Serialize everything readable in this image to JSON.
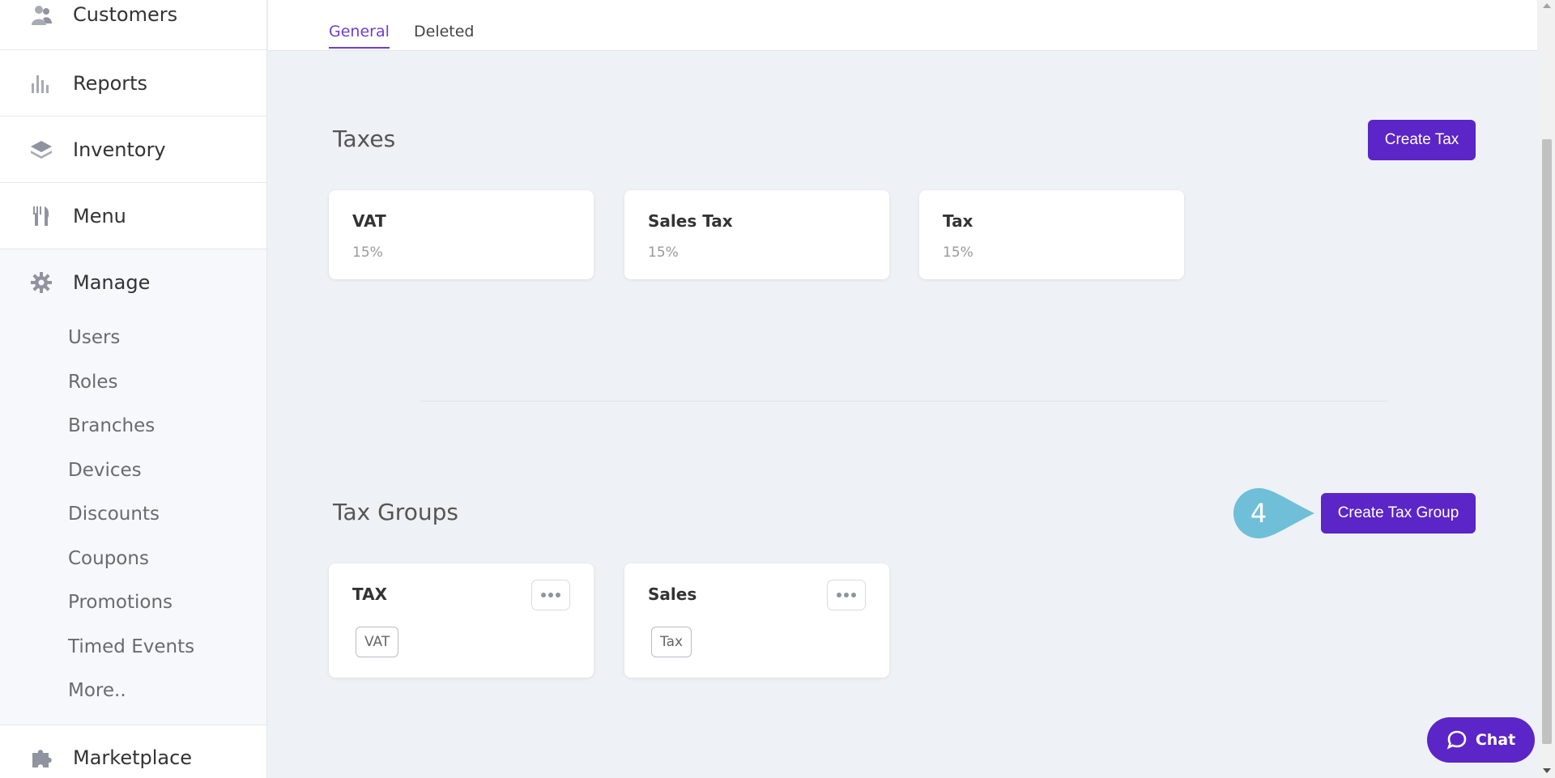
{
  "sidebar": {
    "items": [
      {
        "label": "Customers",
        "icon": "customers-icon"
      },
      {
        "label": "Reports",
        "icon": "reports-icon"
      },
      {
        "label": "Inventory",
        "icon": "inventory-icon"
      },
      {
        "label": "Menu",
        "icon": "menu-icon"
      }
    ],
    "manage": {
      "label": "Manage",
      "icon": "gear-icon",
      "subitems": [
        "Users",
        "Roles",
        "Branches",
        "Devices",
        "Discounts",
        "Coupons",
        "Promotions",
        "Timed Events",
        "More.."
      ]
    },
    "marketplace": {
      "label": "Marketplace",
      "icon": "puzzle-icon"
    }
  },
  "tabs": [
    {
      "label": "General",
      "active": true
    },
    {
      "label": "Deleted",
      "active": false
    }
  ],
  "taxes": {
    "title": "Taxes",
    "create_label": "Create Tax",
    "items": [
      {
        "name": "VAT",
        "rate": "15%"
      },
      {
        "name": "Sales Tax",
        "rate": "15%"
      },
      {
        "name": "Tax",
        "rate": "15%"
      }
    ]
  },
  "tax_groups": {
    "title": "Tax Groups",
    "create_label": "Create Tax Group",
    "step_number": "4",
    "items": [
      {
        "name": "TAX",
        "tags": [
          "VAT"
        ]
      },
      {
        "name": "Sales",
        "tags": [
          "Tax"
        ]
      }
    ]
  },
  "chat": {
    "label": "Chat"
  },
  "colors": {
    "accent": "#5b25c7",
    "tab_active": "#6c3fd1",
    "step_badge": "#6fbfd8",
    "background": "#eef1f5"
  }
}
